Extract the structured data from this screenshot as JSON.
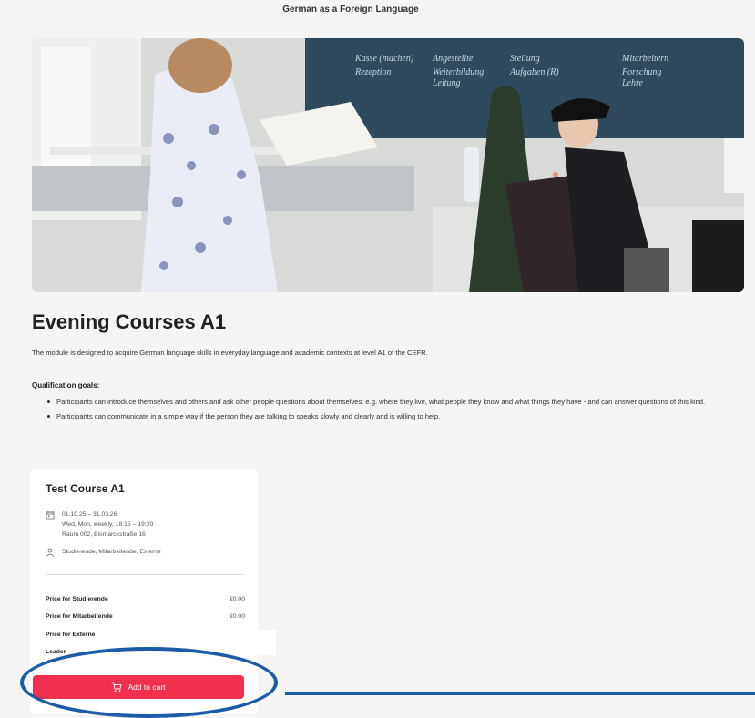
{
  "page": {
    "top_title": "German as a Foreign Language",
    "course_title": "Evening Courses A1",
    "intro": "The module is designed to acquire German language skills in everyday language and academic contexts at level A1 of the CEFR.",
    "goals_heading": "Qualification goals:",
    "goals": [
      "Participants can introduce themselves and others and ask other people questions about themselves: e.g. where they live, what people they know and what things they have - and can answer questions of this kind.",
      "Participants can communicate in a simple way if the person they are talking to speaks slowly and clearly and is willing to help."
    ]
  },
  "hero": {
    "board_words": [
      "Kasse (machen)",
      "Angestellte",
      "Stellung",
      "Mitarbeitern",
      "Rezeption",
      "Weiterbildung",
      "Aufgaben (R)",
      "Forschung",
      "Leitung",
      "Lehre"
    ]
  },
  "card": {
    "title": "Test Course A1",
    "date_range": "01.10.25 – 31.03.26",
    "schedule": "Wed, Mon, weekly, 18:15 – 19:20",
    "location": "Raum 002, Bismarckstraße 16",
    "audience": "Studierende, Mitarbeitende, Externe",
    "prices": [
      {
        "label": "Price for Studierende",
        "value": "€0.00"
      },
      {
        "label": "Price for Mitarbeitende",
        "value": "€0.00"
      },
      {
        "label": "Price for Externe",
        "value": ""
      },
      {
        "label": "Leader",
        "value": ""
      }
    ],
    "cart_label": "Add to cart"
  },
  "colors": {
    "accent": "#f0304e",
    "annotation": "#1d5aa8",
    "board": "#2f4a5c"
  }
}
